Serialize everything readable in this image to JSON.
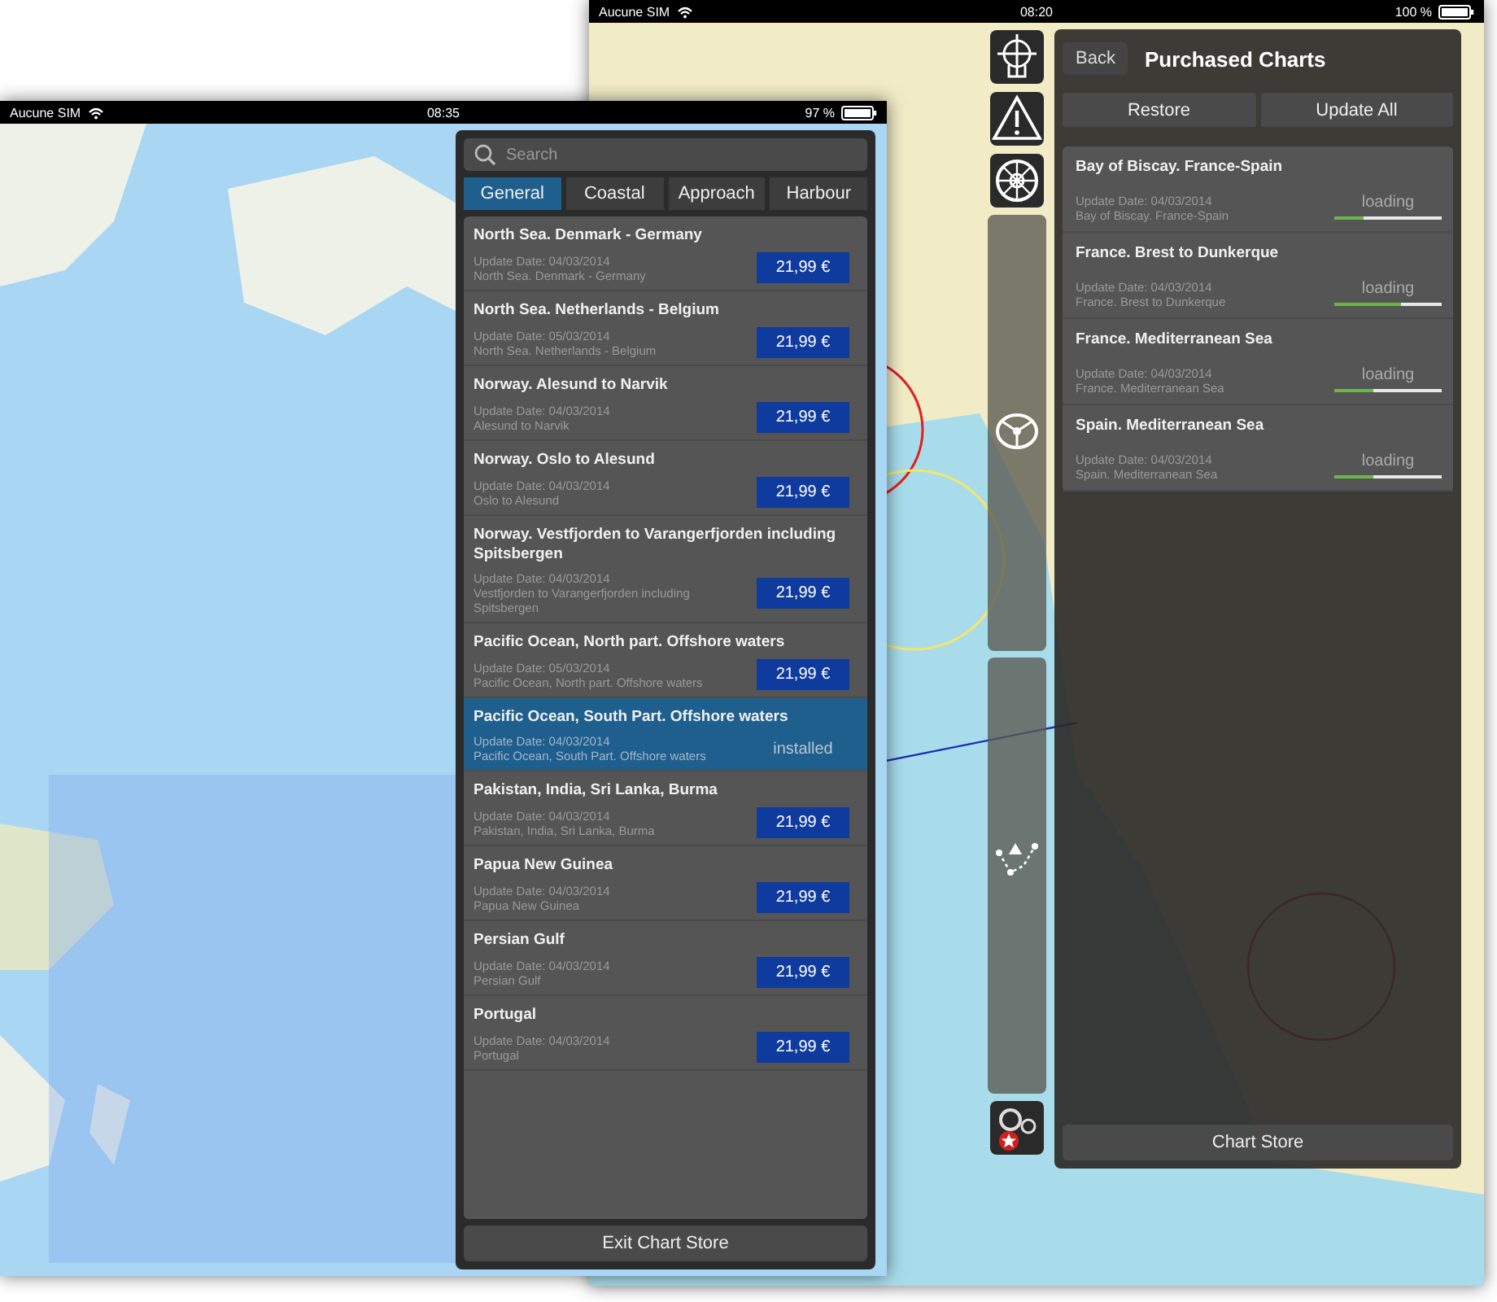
{
  "back_device": {
    "status_bar": {
      "carrier": "Aucune SIM",
      "time": "08:20",
      "battery": "100 %"
    },
    "purchased_panel": {
      "back_button": "Back",
      "title": "Purchased Charts",
      "actions": [
        "Restore",
        "Update All"
      ],
      "charts": [
        {
          "name": "Bay of Biscay. France-Spain",
          "update_date": "Update Date: 04/03/2014",
          "description": "Bay of Biscay. France-Spain",
          "status": "loading",
          "level": 0.27
        },
        {
          "name": "France. Brest to Dunkerque",
          "update_date": "Update Date: 04/03/2014",
          "description": "France. Brest to Dunkerque",
          "status": "loading",
          "level": 0.62
        },
        {
          "name": "France. Mediterranean Sea",
          "update_date": "Update Date: 04/03/2014",
          "description": "France. Mediterranean Sea",
          "status": "loading",
          "level": 0.37
        },
        {
          "name": "Spain. Mediterranean Sea",
          "update_date": "Update Date: 04/03/2014",
          "description": "Spain. Mediterranean Sea",
          "status": "loading",
          "level": 0.37
        }
      ],
      "store_button": "Chart Store"
    }
  },
  "front_device": {
    "status_bar": {
      "carrier": "Aucune SIM",
      "time": "08:35",
      "battery": "97 %"
    },
    "store_panel": {
      "search": {
        "placeholder": "Search"
      },
      "tabs": [
        {
          "label": "General",
          "selected": true
        },
        {
          "label": "Coastal",
          "selected": false
        },
        {
          "label": "Approach",
          "selected": false
        },
        {
          "label": "Harbour",
          "selected": false
        }
      ],
      "charts": [
        {
          "name": "North Sea. Denmark - Germany",
          "update_date": "Update Date: 04/03/2014",
          "description": "North Sea. Denmark - Germany",
          "kind": "price",
          "action": "21,99 €",
          "selected": false
        },
        {
          "name": "North Sea. Netherlands - Belgium",
          "update_date": "Update Date: 05/03/2014",
          "description": "North Sea. Netherlands - Belgium",
          "kind": "price",
          "action": "21,99 €",
          "selected": false
        },
        {
          "name": "Norway. Alesund to Narvik",
          "update_date": "Update Date: 04/03/2014",
          "description": "Alesund to Narvik",
          "kind": "price",
          "action": "21,99 €",
          "selected": false
        },
        {
          "name": "Norway. Oslo to Alesund",
          "update_date": "Update Date: 04/03/2014",
          "description": "Oslo to Alesund",
          "kind": "price",
          "action": "21,99 €",
          "selected": false
        },
        {
          "name": "Norway. Vestfjorden to Varangerfjorden including Spitsbergen",
          "update_date": "Update Date: 04/03/2014",
          "description": "Vestfjorden to Varangerfjorden including Spitsbergen",
          "kind": "price",
          "action": "21,99 €",
          "selected": false
        },
        {
          "name": "Pacific Ocean, North part. Offshore waters",
          "update_date": "Update Date: 05/03/2014",
          "description": "Pacific Ocean, North part. Offshore waters",
          "kind": "price",
          "action": "21,99 €",
          "selected": false
        },
        {
          "name": "Pacific Ocean, South Part. Offshore waters",
          "update_date": "Update Date: 04/03/2014",
          "description": "Pacific Ocean, South Part. Offshore waters",
          "kind": "installed",
          "action": "installed",
          "selected": true
        },
        {
          "name": "Pakistan, India, Sri Lanka, Burma",
          "update_date": "Update Date: 04/03/2014",
          "description": "Pakistan, India, Sri Lanka, Burma",
          "kind": "price",
          "action": "21,99 €",
          "selected": false
        },
        {
          "name": "Papua New Guinea",
          "update_date": "Update Date: 04/03/2014",
          "description": "Papua New Guinea",
          "kind": "price",
          "action": "21,99 €",
          "selected": false
        },
        {
          "name": "Persian Gulf",
          "update_date": "Update Date: 04/03/2014",
          "description": "Persian Gulf",
          "kind": "price",
          "action": "21,99 €",
          "selected": false
        },
        {
          "name": "Portugal",
          "update_date": "Update Date: 04/03/2014",
          "description": "Portugal",
          "kind": "price",
          "action": "21,99 €",
          "selected": false
        }
      ],
      "exit_button": "Exit Chart Store"
    }
  }
}
